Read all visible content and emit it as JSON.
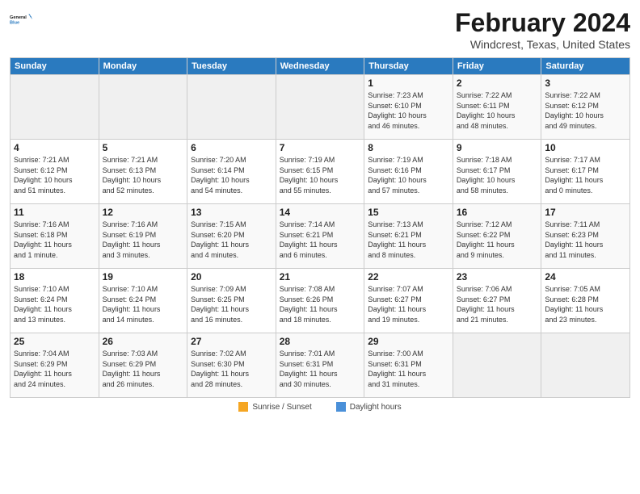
{
  "header": {
    "logo_line1": "General",
    "logo_line2": "Blue",
    "month_title": "February 2024",
    "location": "Windcrest, Texas, United States"
  },
  "days_of_week": [
    "Sunday",
    "Monday",
    "Tuesday",
    "Wednesday",
    "Thursday",
    "Friday",
    "Saturday"
  ],
  "weeks": [
    [
      {
        "num": "",
        "info": ""
      },
      {
        "num": "",
        "info": ""
      },
      {
        "num": "",
        "info": ""
      },
      {
        "num": "",
        "info": ""
      },
      {
        "num": "1",
        "info": "Sunrise: 7:23 AM\nSunset: 6:10 PM\nDaylight: 10 hours\nand 46 minutes."
      },
      {
        "num": "2",
        "info": "Sunrise: 7:22 AM\nSunset: 6:11 PM\nDaylight: 10 hours\nand 48 minutes."
      },
      {
        "num": "3",
        "info": "Sunrise: 7:22 AM\nSunset: 6:12 PM\nDaylight: 10 hours\nand 49 minutes."
      }
    ],
    [
      {
        "num": "4",
        "info": "Sunrise: 7:21 AM\nSunset: 6:12 PM\nDaylight: 10 hours\nand 51 minutes."
      },
      {
        "num": "5",
        "info": "Sunrise: 7:21 AM\nSunset: 6:13 PM\nDaylight: 10 hours\nand 52 minutes."
      },
      {
        "num": "6",
        "info": "Sunrise: 7:20 AM\nSunset: 6:14 PM\nDaylight: 10 hours\nand 54 minutes."
      },
      {
        "num": "7",
        "info": "Sunrise: 7:19 AM\nSunset: 6:15 PM\nDaylight: 10 hours\nand 55 minutes."
      },
      {
        "num": "8",
        "info": "Sunrise: 7:19 AM\nSunset: 6:16 PM\nDaylight: 10 hours\nand 57 minutes."
      },
      {
        "num": "9",
        "info": "Sunrise: 7:18 AM\nSunset: 6:17 PM\nDaylight: 10 hours\nand 58 minutes."
      },
      {
        "num": "10",
        "info": "Sunrise: 7:17 AM\nSunset: 6:17 PM\nDaylight: 11 hours\nand 0 minutes."
      }
    ],
    [
      {
        "num": "11",
        "info": "Sunrise: 7:16 AM\nSunset: 6:18 PM\nDaylight: 11 hours\nand 1 minute."
      },
      {
        "num": "12",
        "info": "Sunrise: 7:16 AM\nSunset: 6:19 PM\nDaylight: 11 hours\nand 3 minutes."
      },
      {
        "num": "13",
        "info": "Sunrise: 7:15 AM\nSunset: 6:20 PM\nDaylight: 11 hours\nand 4 minutes."
      },
      {
        "num": "14",
        "info": "Sunrise: 7:14 AM\nSunset: 6:21 PM\nDaylight: 11 hours\nand 6 minutes."
      },
      {
        "num": "15",
        "info": "Sunrise: 7:13 AM\nSunset: 6:21 PM\nDaylight: 11 hours\nand 8 minutes."
      },
      {
        "num": "16",
        "info": "Sunrise: 7:12 AM\nSunset: 6:22 PM\nDaylight: 11 hours\nand 9 minutes."
      },
      {
        "num": "17",
        "info": "Sunrise: 7:11 AM\nSunset: 6:23 PM\nDaylight: 11 hours\nand 11 minutes."
      }
    ],
    [
      {
        "num": "18",
        "info": "Sunrise: 7:10 AM\nSunset: 6:24 PM\nDaylight: 11 hours\nand 13 minutes."
      },
      {
        "num": "19",
        "info": "Sunrise: 7:10 AM\nSunset: 6:24 PM\nDaylight: 11 hours\nand 14 minutes."
      },
      {
        "num": "20",
        "info": "Sunrise: 7:09 AM\nSunset: 6:25 PM\nDaylight: 11 hours\nand 16 minutes."
      },
      {
        "num": "21",
        "info": "Sunrise: 7:08 AM\nSunset: 6:26 PM\nDaylight: 11 hours\nand 18 minutes."
      },
      {
        "num": "22",
        "info": "Sunrise: 7:07 AM\nSunset: 6:27 PM\nDaylight: 11 hours\nand 19 minutes."
      },
      {
        "num": "23",
        "info": "Sunrise: 7:06 AM\nSunset: 6:27 PM\nDaylight: 11 hours\nand 21 minutes."
      },
      {
        "num": "24",
        "info": "Sunrise: 7:05 AM\nSunset: 6:28 PM\nDaylight: 11 hours\nand 23 minutes."
      }
    ],
    [
      {
        "num": "25",
        "info": "Sunrise: 7:04 AM\nSunset: 6:29 PM\nDaylight: 11 hours\nand 24 minutes."
      },
      {
        "num": "26",
        "info": "Sunrise: 7:03 AM\nSunset: 6:29 PM\nDaylight: 11 hours\nand 26 minutes."
      },
      {
        "num": "27",
        "info": "Sunrise: 7:02 AM\nSunset: 6:30 PM\nDaylight: 11 hours\nand 28 minutes."
      },
      {
        "num": "28",
        "info": "Sunrise: 7:01 AM\nSunset: 6:31 PM\nDaylight: 11 hours\nand 30 minutes."
      },
      {
        "num": "29",
        "info": "Sunrise: 7:00 AM\nSunset: 6:31 PM\nDaylight: 11 hours\nand 31 minutes."
      },
      {
        "num": "",
        "info": ""
      },
      {
        "num": "",
        "info": ""
      }
    ]
  ],
  "footer": {
    "sunrise_label": "Sunrise / Sunset",
    "daylight_label": "Daylight hours"
  }
}
